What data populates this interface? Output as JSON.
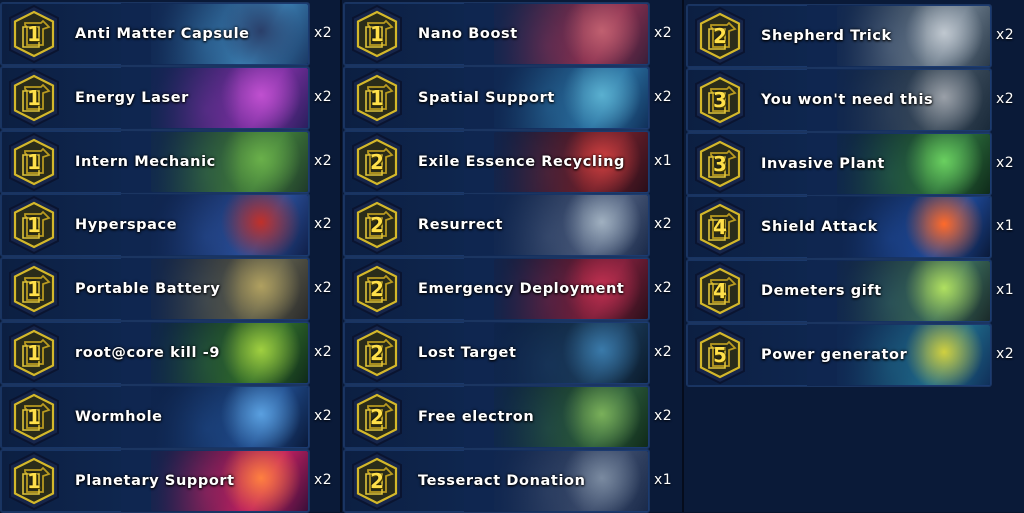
{
  "columns": [
    {
      "cards": [
        {
          "name": "Anti Matter Capsule",
          "level": "1",
          "count": "x2",
          "art": [
            "#1b3a66",
            "#3a7db0",
            "#2a3f6a"
          ]
        },
        {
          "name": "Energy Laser",
          "level": "1",
          "count": "x2",
          "art": [
            "#2a1f5e",
            "#7a2fa0",
            "#c050d0"
          ]
        },
        {
          "name": "Intern Mechanic",
          "level": "1",
          "count": "x2",
          "art": [
            "#1f3a2a",
            "#3f7a3a",
            "#6ab04a"
          ]
        },
        {
          "name": "Hyperspace",
          "level": "1",
          "count": "x2",
          "art": [
            "#10204a",
            "#2a4f9a",
            "#c0302a"
          ]
        },
        {
          "name": "Portable Battery",
          "level": "1",
          "count": "x2",
          "art": [
            "#2a2a2a",
            "#5a5a4a",
            "#b0a060"
          ]
        },
        {
          "name": "root@core kill -9",
          "level": "1",
          "count": "x2",
          "art": [
            "#0f2a1a",
            "#2f6a2a",
            "#a0d040"
          ]
        },
        {
          "name": "Wormhole",
          "level": "1",
          "count": "x2",
          "art": [
            "#0a1a3a",
            "#1f4a8a",
            "#5aa0e0"
          ]
        },
        {
          "name": "Planetary Support",
          "level": "1",
          "count": "x2",
          "art": [
            "#3a0f3a",
            "#c02060",
            "#ff8040"
          ]
        }
      ]
    },
    {
      "cards": [
        {
          "name": "Nano Boost",
          "level": "1",
          "count": "x2",
          "art": [
            "#3a1f3a",
            "#8a3050",
            "#c06070"
          ]
        },
        {
          "name": "Spatial Support",
          "level": "1",
          "count": "x2",
          "art": [
            "#10305a",
            "#2a70a0",
            "#5ab0d0"
          ]
        },
        {
          "name": "Exile Essence Recycling",
          "level": "2",
          "count": "x1",
          "art": [
            "#2a0f1a",
            "#6a1f2a",
            "#d04040"
          ]
        },
        {
          "name": "Resurrect",
          "level": "2",
          "count": "x2",
          "art": [
            "#1a2a4a",
            "#4a5a7a",
            "#a0b0c0"
          ]
        },
        {
          "name": "Emergency Deployment",
          "level": "2",
          "count": "x2",
          "art": [
            "#2a0f1a",
            "#7a1f3a",
            "#c03050"
          ]
        },
        {
          "name": "Lost Target",
          "level": "2",
          "count": "x2",
          "art": [
            "#0a1a2a",
            "#1a3a5a",
            "#3a7aaa"
          ]
        },
        {
          "name": "Free electron",
          "level": "2",
          "count": "x2",
          "art": [
            "#102a1a",
            "#2a5a3a",
            "#7ab05a"
          ]
        },
        {
          "name": "Tesseract Donation",
          "level": "2",
          "count": "x1",
          "art": [
            "#1a2a4a",
            "#3a4a6a",
            "#7a8aa0"
          ]
        }
      ]
    },
    {
      "cards": [
        {
          "name": "Shepherd Trick",
          "level": "2",
          "count": "x2",
          "art": [
            "#2a3a4a",
            "#6a7a8a",
            "#c0c8d0"
          ]
        },
        {
          "name": "You won't need this",
          "level": "3",
          "count": "x2",
          "art": [
            "#1a2a3a",
            "#3a4a5a",
            "#9aa0a8"
          ]
        },
        {
          "name": "Invasive Plant",
          "level": "3",
          "count": "x2",
          "art": [
            "#0f2a1a",
            "#2a6a3a",
            "#6ad060"
          ]
        },
        {
          "name": "Shield Attack",
          "level": "4",
          "count": "x1",
          "art": [
            "#0a1a3a",
            "#1f4a9a",
            "#ff6a2a"
          ]
        },
        {
          "name": "Demeters gift",
          "level": "4",
          "count": "x1",
          "art": [
            "#1a2a2a",
            "#3a6a5a",
            "#b0e060"
          ]
        },
        {
          "name": "Power generator",
          "level": "5",
          "count": "x2",
          "art": [
            "#10305a",
            "#1f6a8a",
            "#d0d040"
          ]
        }
      ]
    }
  ],
  "colors": {
    "badge_fill": "#2a2c1a",
    "badge_ring": "#d4b82a",
    "badge_number": "#ffe04a",
    "card_border": "#1b3561",
    "background": "#0a1a38"
  }
}
